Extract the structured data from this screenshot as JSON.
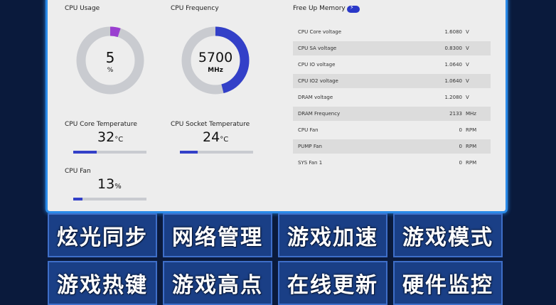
{
  "panel": {
    "cpu_usage": {
      "label": "CPU Usage",
      "value": "5",
      "unit": "%",
      "fraction": 0.05
    },
    "cpu_frequency": {
      "label": "CPU Frequency",
      "value": "5700",
      "unit": "MHz",
      "fraction": 0.46
    },
    "cpu_core_temp": {
      "label": "CPU Core Temperature",
      "value": "32",
      "unit": "°C",
      "fraction": 0.32
    },
    "cpu_socket_temp": {
      "label": "CPU Socket Temperature",
      "value": "24",
      "unit": "°C",
      "fraction": 0.24
    },
    "cpu_fan": {
      "label": "CPU Fan",
      "value": "13",
      "unit": "%",
      "fraction": 0.13
    },
    "free_up_memory": {
      "label": "Free Up Memory"
    },
    "readings": [
      {
        "name": "CPU Core voltage",
        "value": "1.6080",
        "unit": "V"
      },
      {
        "name": "CPU SA voltage",
        "value": "0.8300",
        "unit": "V"
      },
      {
        "name": "CPU IO voltage",
        "value": "1.0640",
        "unit": "V"
      },
      {
        "name": "CPU IO2 voltage",
        "value": "1.0640",
        "unit": "V"
      },
      {
        "name": "DRAM voltage",
        "value": "1.2080",
        "unit": "V"
      },
      {
        "name": "DRAM Frequency",
        "value": "2133",
        "unit": "MHz"
      },
      {
        "name": "CPU Fan",
        "value": "0",
        "unit": "RPM"
      },
      {
        "name": "PUMP Fan",
        "value": "0",
        "unit": "RPM"
      },
      {
        "name": "SYS Fan 1",
        "value": "0",
        "unit": "RPM"
      }
    ]
  },
  "colors": {
    "accent": "#3340c8",
    "accent_tip": "#9a3fd0",
    "track": "#c9cbd0"
  },
  "features": [
    {
      "label": "炫光同步"
    },
    {
      "label": "网络管理"
    },
    {
      "label": "游戏加速"
    },
    {
      "label": "游戏模式"
    },
    {
      "label": "游戏热键"
    },
    {
      "label": "游戏高点"
    },
    {
      "label": "在线更新"
    },
    {
      "label": "硬件监控"
    }
  ]
}
